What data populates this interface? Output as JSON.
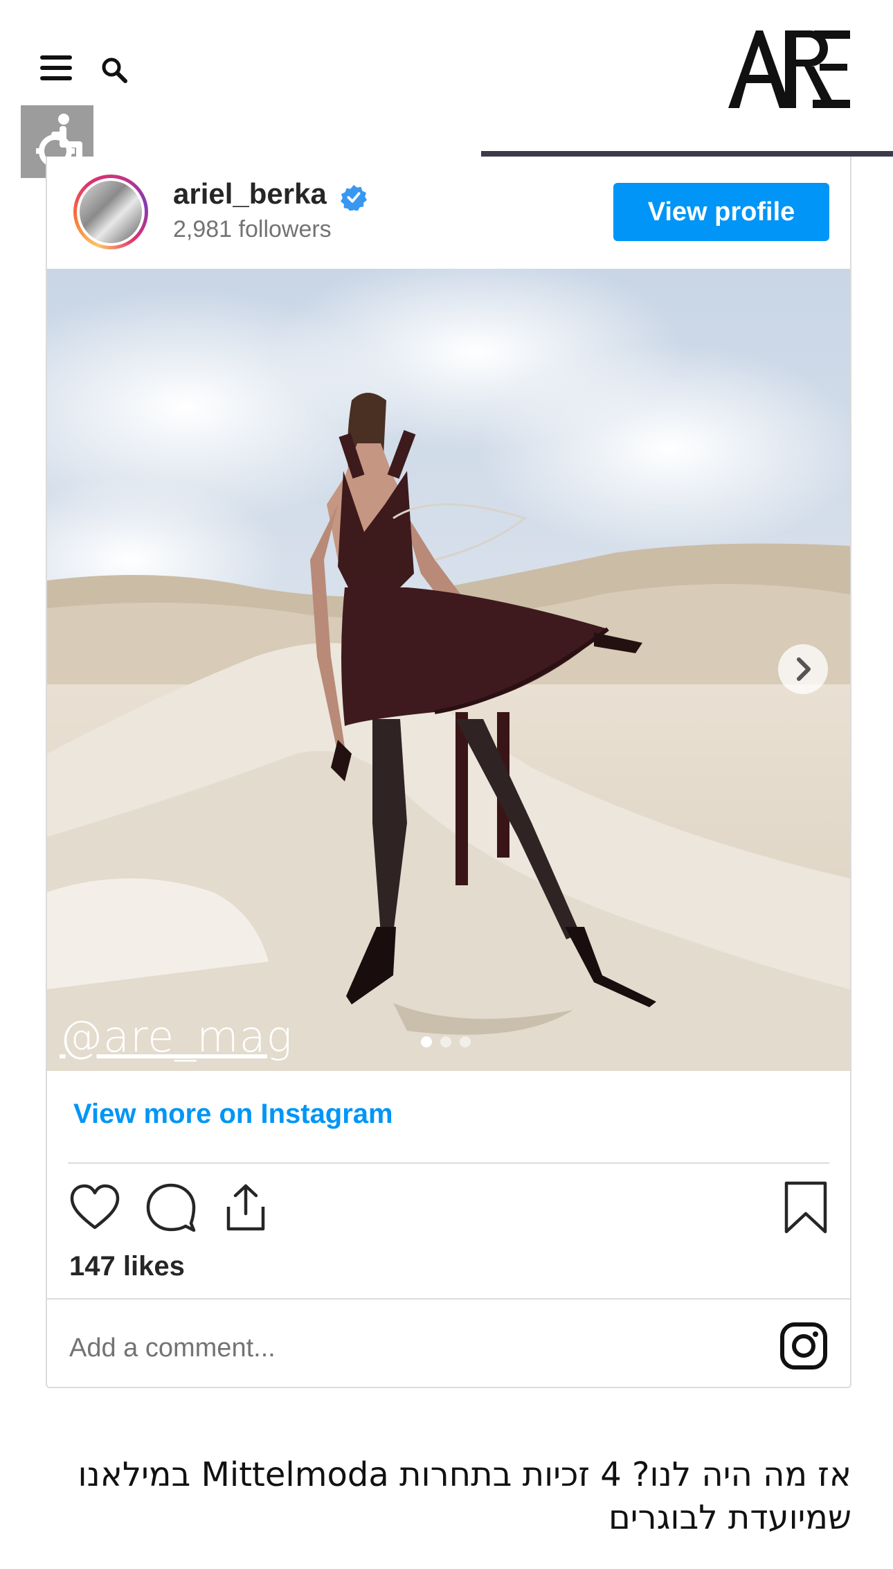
{
  "header": {
    "menu_icon": "hamburger-menu-icon",
    "search_icon": "search-icon",
    "logo_text": "ARE",
    "accessibility_icon": "wheelchair-icon"
  },
  "instagram_post": {
    "username": "ariel_berka",
    "verified": true,
    "followers": "2,981 followers",
    "view_profile_label": "View profile",
    "watermark": "@are_mag",
    "carousel": {
      "count": 3,
      "active": 1
    },
    "view_more_label": "View more on Instagram",
    "actions": [
      "heart-icon",
      "comment-icon",
      "share-icon",
      "bookmark-icon"
    ],
    "likes": "147 likes",
    "comment_placeholder": "Add a comment...",
    "instagram_icon": "instagram-icon"
  },
  "article": {
    "title": "אז מה היה לנו? 4 זכיות בתחרות Mittelmoda במילאנו שמיועדת לבוגרים"
  },
  "colors": {
    "accent_blue": "#0095f6",
    "header_line": "#3b3b4a",
    "access_button_bg": "#9c9c9c"
  }
}
